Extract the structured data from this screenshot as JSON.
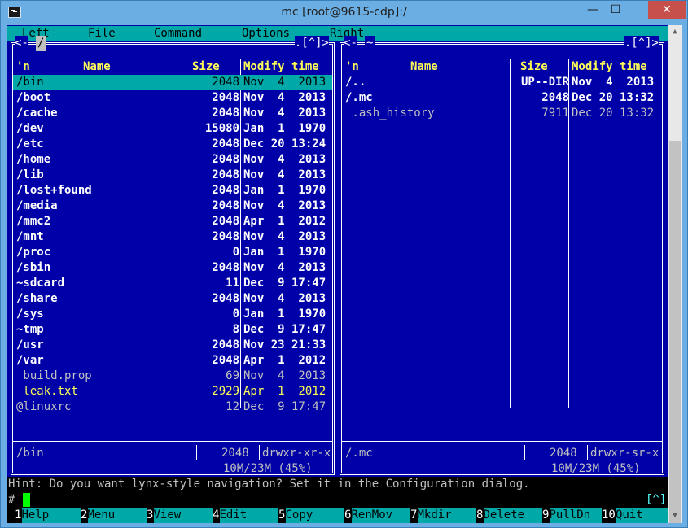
{
  "window": {
    "title": "mc [root@9615-cdp]:/",
    "min_glyph": "—",
    "max_glyph": "☐",
    "close_glyph": "✕"
  },
  "menubar": [
    "Left",
    "File",
    "Command",
    "Options",
    "Right"
  ],
  "left_panel": {
    "path": "/",
    "corner_left": "<-",
    "corner_right": ".[^]>",
    "headers": {
      "n": "'n",
      "name": "Name",
      "size": "Size",
      "modify": "Modify time"
    },
    "rows": [
      {
        "name": "/bin",
        "size": "2048",
        "mtime": "Nov  4  2013",
        "kind": "dir",
        "selected": true
      },
      {
        "name": "/boot",
        "size": "2048",
        "mtime": "Nov  4  2013",
        "kind": "dir"
      },
      {
        "name": "/cache",
        "size": "2048",
        "mtime": "Nov  4  2013",
        "kind": "dir"
      },
      {
        "name": "/dev",
        "size": "15080",
        "mtime": "Jan  1  1970",
        "kind": "dir"
      },
      {
        "name": "/etc",
        "size": "2048",
        "mtime": "Dec 20 13:24",
        "kind": "dir"
      },
      {
        "name": "/home",
        "size": "2048",
        "mtime": "Nov  4  2013",
        "kind": "dir"
      },
      {
        "name": "/lib",
        "size": "2048",
        "mtime": "Nov  4  2013",
        "kind": "dir"
      },
      {
        "name": "/lost+found",
        "size": "2048",
        "mtime": "Jan  1  1970",
        "kind": "dir"
      },
      {
        "name": "/media",
        "size": "2048",
        "mtime": "Nov  4  2013",
        "kind": "dir"
      },
      {
        "name": "/mmc2",
        "size": "2048",
        "mtime": "Apr  1  2012",
        "kind": "dir"
      },
      {
        "name": "/mnt",
        "size": "2048",
        "mtime": "Nov  4  2013",
        "kind": "dir"
      },
      {
        "name": "/proc",
        "size": "0",
        "mtime": "Jan  1  1970",
        "kind": "dir"
      },
      {
        "name": "/sbin",
        "size": "2048",
        "mtime": "Nov  4  2013",
        "kind": "dir"
      },
      {
        "name": "~sdcard",
        "size": "11",
        "mtime": "Dec  9 17:47",
        "kind": "dir"
      },
      {
        "name": "/share",
        "size": "2048",
        "mtime": "Nov  4  2013",
        "kind": "dir"
      },
      {
        "name": "/sys",
        "size": "0",
        "mtime": "Jan  1  1970",
        "kind": "dir"
      },
      {
        "name": "~tmp",
        "size": "8",
        "mtime": "Dec  9 17:47",
        "kind": "dir"
      },
      {
        "name": "/usr",
        "size": "2048",
        "mtime": "Nov 23 21:33",
        "kind": "dir"
      },
      {
        "name": "/var",
        "size": "2048",
        "mtime": "Apr  1  2012",
        "kind": "dir"
      },
      {
        "name": " build.prop",
        "size": "69",
        "mtime": "Nov  4  2013",
        "kind": "file"
      },
      {
        "name": " leak.txt",
        "size": "2929",
        "mtime": "Apr  1  2012",
        "kind": "archive"
      },
      {
        "name": "@linuxrc",
        "size": "12",
        "mtime": "Dec  9 17:47",
        "kind": "link"
      }
    ],
    "status_name": "/bin",
    "status_size": "2048",
    "status_perms": "drwxr-xr-x",
    "free_space": "10M/23M (45%)"
  },
  "right_panel": {
    "path": "~",
    "corner_left": "<-",
    "corner_right": ".[^]>",
    "headers": {
      "n": "'n",
      "name": "Name",
      "size": "Size",
      "modify": "Modify time"
    },
    "rows": [
      {
        "name": "/..",
        "size": "UP--DIR",
        "mtime": "Nov  4  2013",
        "kind": "dir"
      },
      {
        "name": "/.mc",
        "size": "2048",
        "mtime": "Dec 20 13:32",
        "kind": "dir"
      },
      {
        "name": " .ash_history",
        "size": "7911",
        "mtime": "Dec 20 13:32",
        "kind": "file"
      }
    ],
    "status_name": "/.mc",
    "status_size": "2048",
    "status_perms": "drwxr-sr-x",
    "free_space": "10M/23M (45%)"
  },
  "hint": "Hint: Do you want lynx-style navigation? Set it in the Configuration dialog.",
  "command": {
    "prompt": "#",
    "caret_button": "[^]"
  },
  "keybar": [
    {
      "num": "1",
      "label": "Help"
    },
    {
      "num": "2",
      "label": "Menu"
    },
    {
      "num": "3",
      "label": "View"
    },
    {
      "num": "4",
      "label": "Edit"
    },
    {
      "num": "5",
      "label": "Copy"
    },
    {
      "num": "6",
      "label": "RenMov"
    },
    {
      "num": "7",
      "label": "Mkdir"
    },
    {
      "num": "8",
      "label": "Delete"
    },
    {
      "num": "9",
      "label": "PullDn"
    },
    {
      "num": "10",
      "label": "Quit"
    }
  ],
  "colors": {
    "panel_bg": "#0000a8",
    "accent": "#00a8a8",
    "header": "#ffff55"
  }
}
